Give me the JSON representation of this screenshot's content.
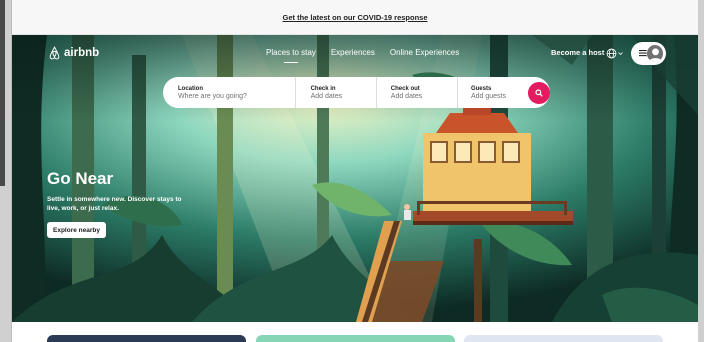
{
  "banner": {
    "link": "Get the latest on our COVID-19 response"
  },
  "brand": {
    "name": "airbnb",
    "accent": "#e31c5f"
  },
  "nav": {
    "tabs": [
      {
        "label": "Places to stay",
        "active": true
      },
      {
        "label": "Experiences",
        "active": false
      },
      {
        "label": "Online Experiences",
        "active": false
      }
    ],
    "host": "Become a host",
    "globe_icon": "globe-icon",
    "menu_icon": "hamburger-icon",
    "avatar_icon": "user-avatar-icon"
  },
  "search": {
    "location": {
      "label": "Location",
      "placeholder": "Where are you going?"
    },
    "checkin": {
      "label": "Check in",
      "placeholder": "Add dates"
    },
    "checkout": {
      "label": "Check out",
      "placeholder": "Add dates"
    },
    "guests": {
      "label": "Guests",
      "placeholder": "Add guests"
    },
    "button_icon": "search-icon"
  },
  "hero": {
    "title": "Go Near",
    "subtitle": "Settle in somewhere new. Discover stays to live, work, or just relax.",
    "cta": "Explore nearby"
  },
  "cards": {
    "colors": [
      "#2b3a55",
      "#86d6b5",
      "#dfe6f2"
    ]
  }
}
